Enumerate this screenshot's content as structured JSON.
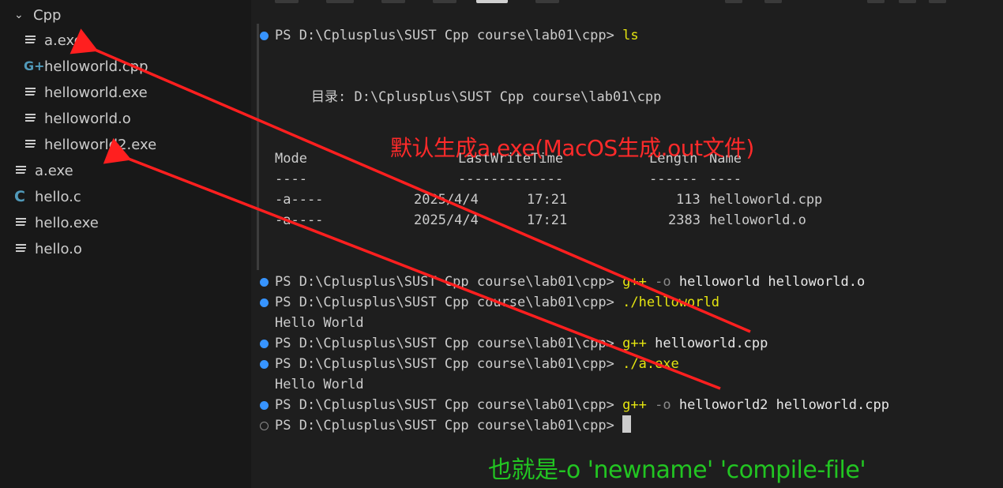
{
  "sidebar": {
    "folder": {
      "label": "Cpp",
      "icon": "chevron-down-icon"
    },
    "items": [
      {
        "label": "a.exe",
        "icon": "file-lines-icon"
      },
      {
        "label": "helloworld.cpp",
        "icon": "cpp-file-icon"
      },
      {
        "label": "helloworld.exe",
        "icon": "file-lines-icon"
      },
      {
        "label": "helloworld.o",
        "icon": "file-lines-icon"
      },
      {
        "label": "helloworld2.exe",
        "icon": "file-lines-icon"
      },
      {
        "label": "a.exe",
        "icon": "file-lines-icon"
      },
      {
        "label": "hello.c",
        "icon": "c-file-icon"
      },
      {
        "label": "hello.exe",
        "icon": "file-lines-icon"
      },
      {
        "label": "hello.o",
        "icon": "file-lines-icon"
      }
    ]
  },
  "terminal": {
    "prompt": "PS D:\\Cplusplus\\SUST Cpp course\\lab01\\cpp>",
    "cmd_ls": "ls",
    "dir_label": "目录: D:\\Cplusplus\\SUST Cpp course\\lab01\\cpp",
    "table": {
      "header": {
        "mode": "Mode",
        "time": "LastWriteTime",
        "length": "Length",
        "name": "Name"
      },
      "rule": {
        "mode": "----",
        "time": "-------------",
        "length": "------",
        "name": "----"
      },
      "rows": [
        {
          "mode": "-a----",
          "date": "2025/4/4",
          "time": "17:21",
          "length": "113",
          "name": "helloworld.cpp"
        },
        {
          "mode": "-a----",
          "date": "2025/4/4",
          "time": "17:21",
          "length": "2383",
          "name": "helloworld.o"
        }
      ]
    },
    "cmd1": {
      "main": "g++",
      "flag": "-o",
      "args": "helloworld helloworld.o"
    },
    "cmd2": {
      "main": "./helloworld"
    },
    "output1": "Hello World",
    "cmd3": {
      "main": "g++",
      "args": "helloworld.cpp"
    },
    "cmd4": {
      "main": "./a.exe"
    },
    "output2": "Hello World",
    "cmd5": {
      "main": "g++",
      "flag": "-o",
      "args": "helloworld2 helloworld.cpp"
    }
  },
  "annotations": {
    "red_note": "默认生成a.exe(MacOS生成.out文件)",
    "green_note": "也就是-o 'newname' 'compile-file'"
  },
  "colors": {
    "annotation_red": "#ff2a2a",
    "annotation_green": "#22c522",
    "command_yellow": "#e5e510",
    "decoration_blue": "#3794ff"
  }
}
